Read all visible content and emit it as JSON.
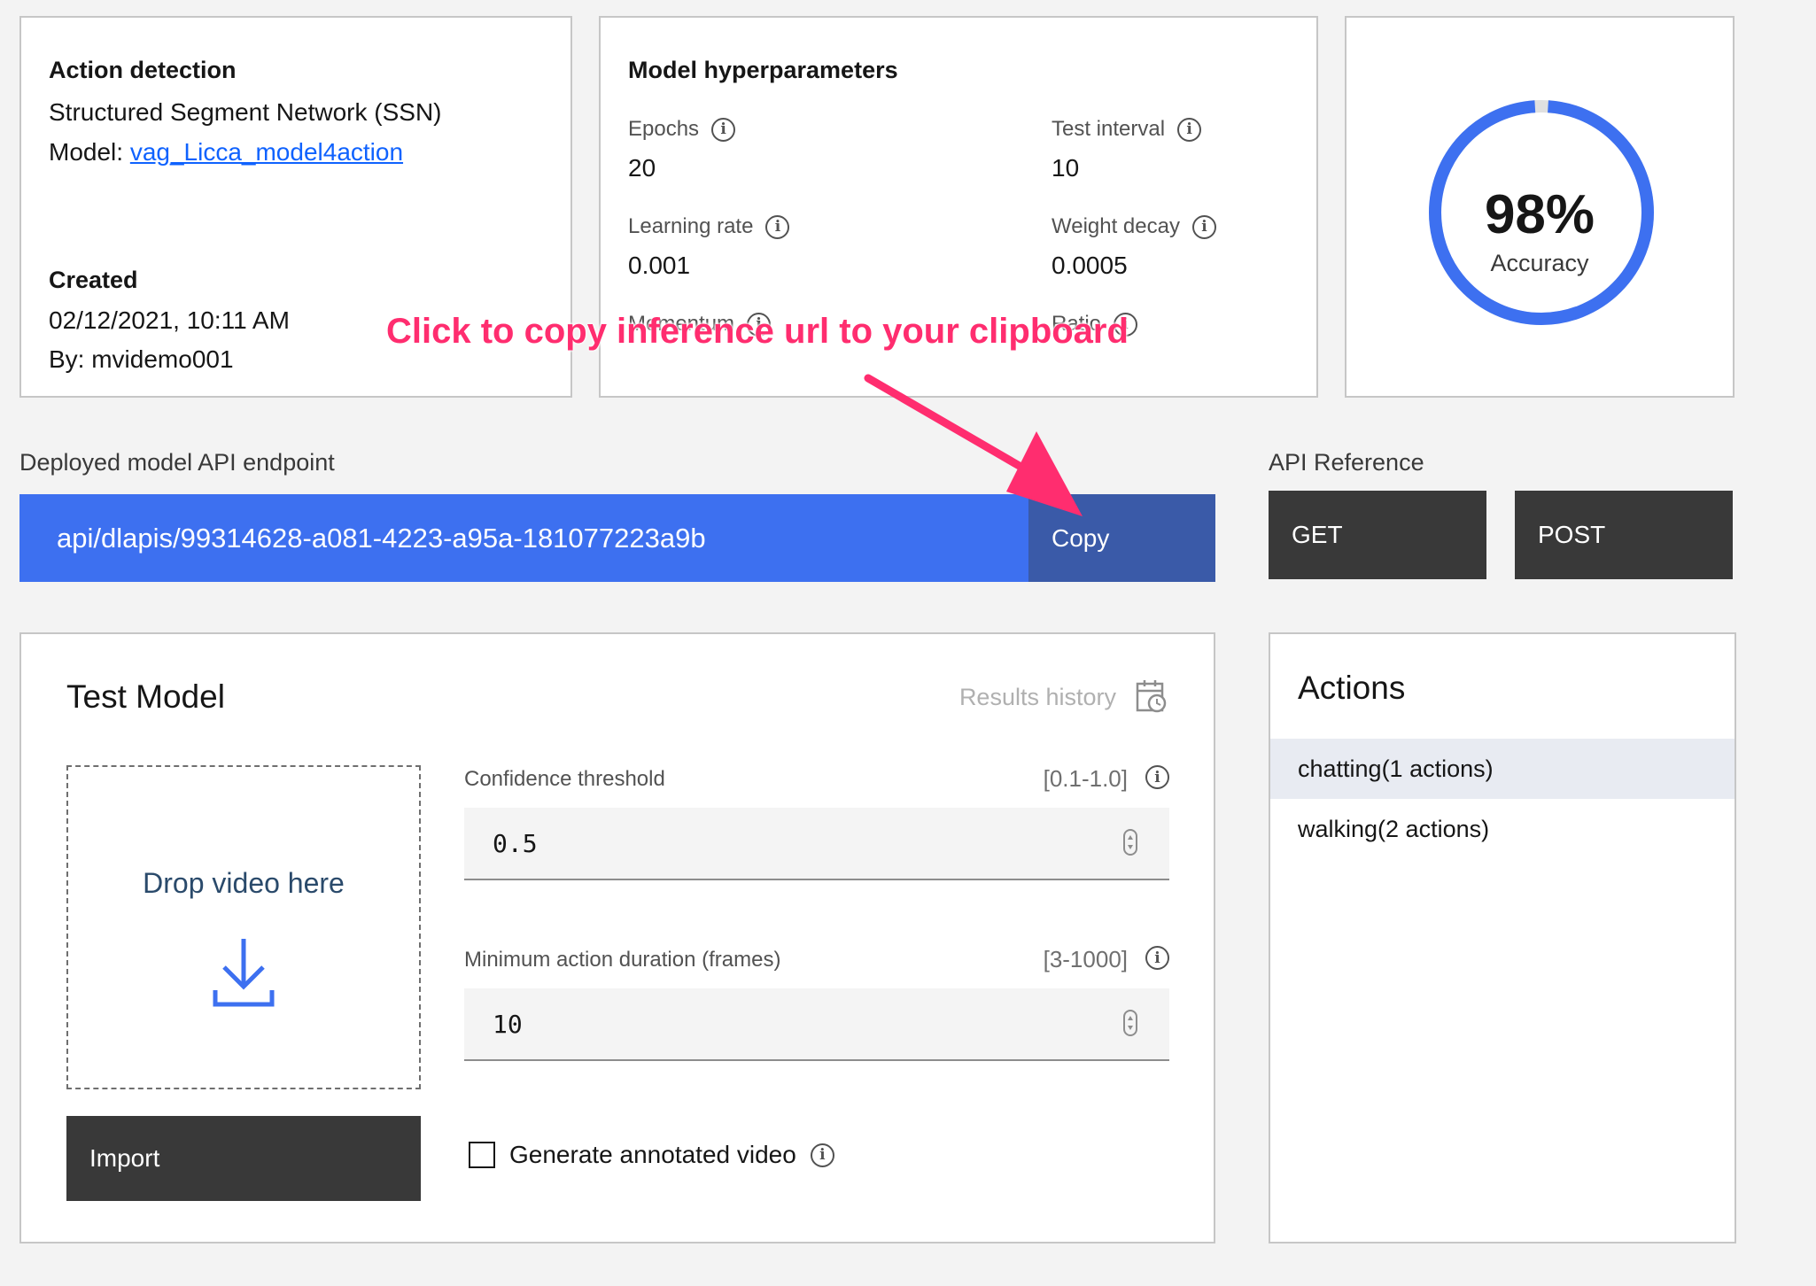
{
  "info_card": {
    "title": "Action detection",
    "network": "Structured Segment Network (SSN)",
    "model_prefix": "Model: ",
    "model_name": "vag_Licca_model4action",
    "created_label": "Created",
    "created_date": "02/12/2021, 10:11 AM",
    "created_by": "By: mvidemo001"
  },
  "hyperparams": {
    "title": "Model hyperparameters",
    "items": [
      {
        "label": "Epochs",
        "value": "20"
      },
      {
        "label": "Test interval",
        "value": "10"
      },
      {
        "label": "Learning rate",
        "value": "0.001"
      },
      {
        "label": "Weight decay",
        "value": "0.0005"
      },
      {
        "label": "Momentum",
        "value": ""
      },
      {
        "label": "Ratio",
        "value": ""
      }
    ]
  },
  "accuracy": {
    "value_text": "98%",
    "fraction": 0.98,
    "label": "Accuracy",
    "ring_color": "#3d70f0",
    "track_color": "#e0e0e0"
  },
  "endpoint": {
    "label": "Deployed model API endpoint",
    "url": "api/dlapis/99314628-a081-4223-a95a-181077223a9b",
    "copy_label": "Copy"
  },
  "api_reference": {
    "label": "API Reference",
    "get_label": "GET",
    "post_label": "POST"
  },
  "test_model": {
    "title": "Test Model",
    "results_history": "Results history",
    "drop_text": "Drop video here",
    "import_label": "Import",
    "confidence": {
      "label": "Confidence threshold",
      "range": "[0.1-1.0]",
      "value": "0.5"
    },
    "min_duration": {
      "label": "Minimum action duration (frames)",
      "range": "[3-1000]",
      "value": "10"
    },
    "generate_label": "Generate annotated video"
  },
  "actions": {
    "title": "Actions",
    "items": [
      {
        "label": "chatting(1 actions)"
      },
      {
        "label": "walking(2 actions)"
      }
    ]
  },
  "annotation": {
    "text": "Click to copy inference url to your clipboard",
    "color": "#ff2d6f"
  },
  "icons": {
    "info": "info-icon",
    "calendar": "calendar-history-icon",
    "download": "download-icon",
    "stepper": "number-stepper-icon"
  }
}
